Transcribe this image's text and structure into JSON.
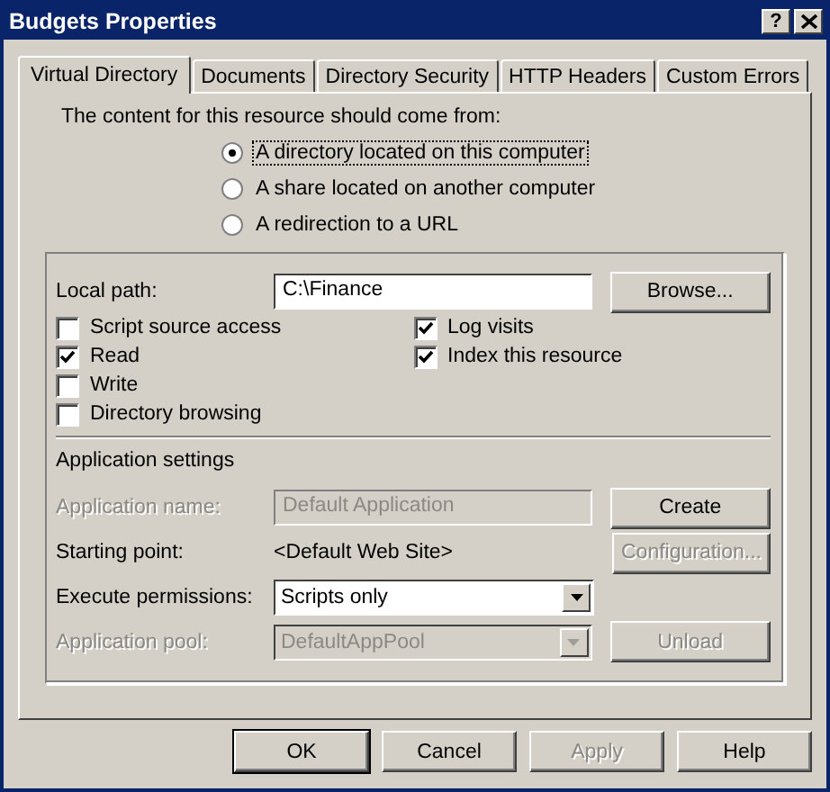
{
  "window": {
    "title": "Budgets Properties",
    "help_button": "?"
  },
  "tabs": [
    {
      "label": "Virtual Directory",
      "selected": true
    },
    {
      "label": "Documents",
      "selected": false
    },
    {
      "label": "Directory Security",
      "selected": false
    },
    {
      "label": "HTTP Headers",
      "selected": false
    },
    {
      "label": "Custom Errors",
      "selected": false
    }
  ],
  "source": {
    "prompt": "The content for this resource should come from:",
    "options": [
      {
        "label": "A directory located on this computer",
        "selected": true
      },
      {
        "label": "A share located on another computer",
        "selected": false
      },
      {
        "label": "A redirection to a URL",
        "selected": false
      }
    ]
  },
  "local_path": {
    "label": "Local path:",
    "value": "C:\\Finance",
    "button": "Browse..."
  },
  "checkboxes_left": [
    {
      "label": "Script source access",
      "checked": false
    },
    {
      "label": "Read",
      "checked": true
    },
    {
      "label": "Write",
      "checked": false
    },
    {
      "label": "Directory browsing",
      "checked": false
    }
  ],
  "checkboxes_right": [
    {
      "label": "Log visits",
      "checked": true
    },
    {
      "label": "Index this resource",
      "checked": true
    }
  ],
  "application_settings": {
    "heading": "Application settings",
    "rows": [
      {
        "kind": "field",
        "label": "Application name:",
        "value": "Default Application",
        "disabled": true,
        "button": "Create",
        "button_disabled": false
      },
      {
        "kind": "text",
        "label": "Starting point:",
        "value": "<Default Web Site>",
        "disabled": false,
        "button": "Configuration...",
        "button_disabled": true
      },
      {
        "kind": "select",
        "label": "Execute permissions:",
        "value": "Scripts only",
        "disabled": false
      },
      {
        "kind": "select",
        "label": "Application pool:",
        "value": "DefaultAppPool",
        "disabled": true,
        "button": "Unload",
        "button_disabled": true
      }
    ]
  },
  "dialog_buttons": [
    {
      "label": "OK",
      "disabled": false,
      "default": true
    },
    {
      "label": "Cancel",
      "disabled": false,
      "default": false
    },
    {
      "label": "Apply",
      "disabled": true,
      "default": false
    },
    {
      "label": "Help",
      "disabled": false,
      "default": false
    }
  ]
}
